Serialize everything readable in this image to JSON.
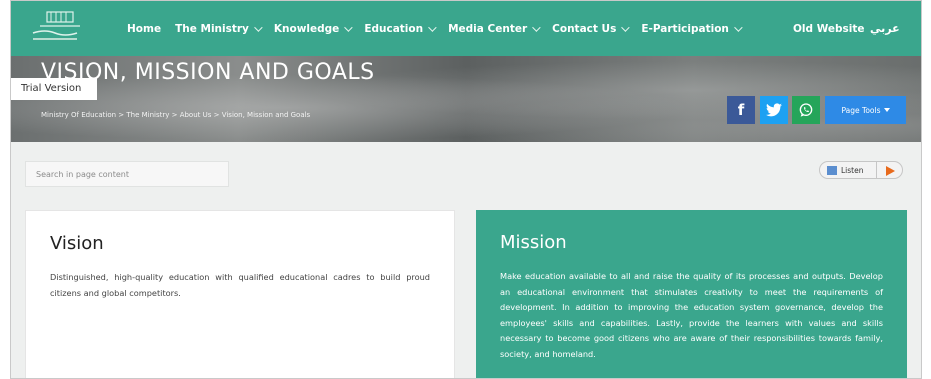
{
  "nav": {
    "items": [
      {
        "label": "Home",
        "has_menu": false
      },
      {
        "label": "The Ministry",
        "has_menu": true
      },
      {
        "label": "Knowledge",
        "has_menu": true
      },
      {
        "label": "Education",
        "has_menu": true
      },
      {
        "label": "Media Center",
        "has_menu": true
      },
      {
        "label": "Contact Us",
        "has_menu": true
      },
      {
        "label": "E-Participation",
        "has_menu": true
      }
    ],
    "old_website": "Old Website",
    "language": "عربي",
    "bg_color": "#3aa68d"
  },
  "hero": {
    "title": "VISION, MISSION AND GOALS",
    "trial_label": "Trial Version",
    "breadcrumb": "Ministry Of Education > The Ministry > About Us > Vision, Mission and Goals",
    "page_tools_label": "Page Tools"
  },
  "share": {
    "facebook_icon": "f",
    "facebook_color": "#3b5998",
    "twitter_color": "#1da1f2",
    "whatsapp_color": "#25a55a"
  },
  "search": {
    "placeholder": "Search in page content"
  },
  "listen": {
    "label": "Listen"
  },
  "vision": {
    "title": "Vision",
    "text": "Distinguished, high-quality education with qualified educational cadres to build proud citizens and global competitors."
  },
  "mission": {
    "title": "Mission",
    "text": "Make education available to all and raise the quality of its processes and outputs. Develop an educational environment that stimulates creativity to meet the requirements of development. In addition to improving the education system governance, develop the employees' skills and capabilities. Lastly, provide the learners with values and skills necessary to become good citizens who are aware of their responsibilities towards family, society, and homeland.",
    "bg_color": "#3aa68d"
  }
}
